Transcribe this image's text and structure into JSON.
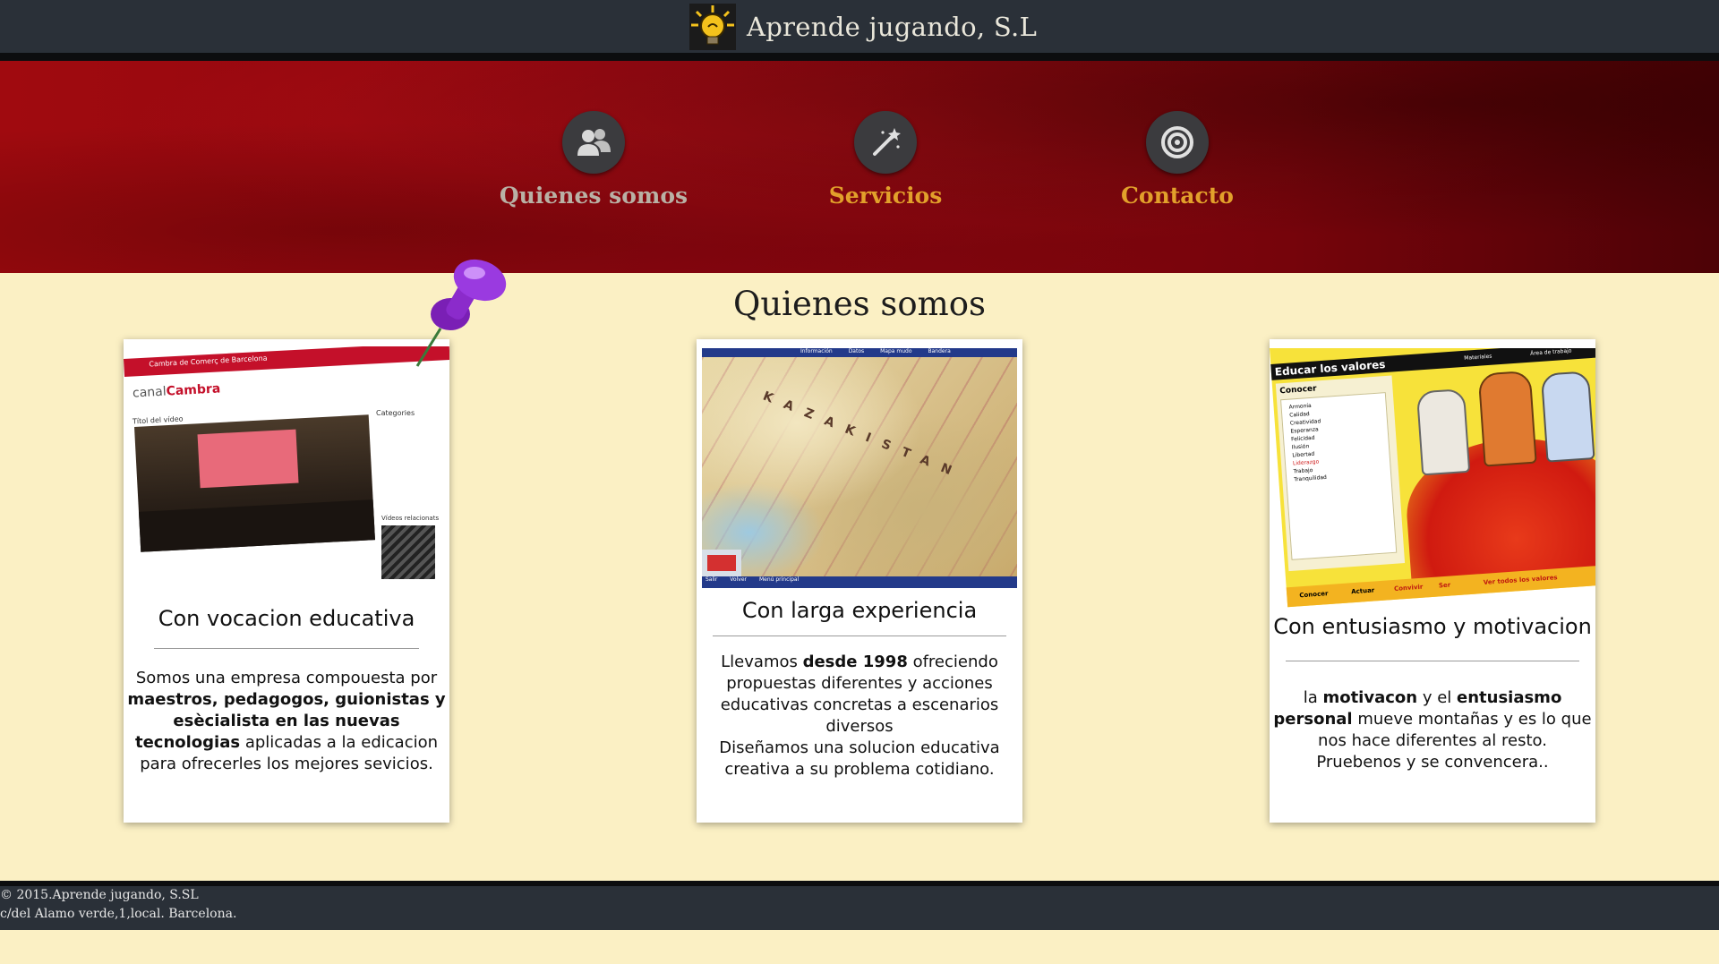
{
  "header": {
    "brand_name": "Aprende jugando, S.L"
  },
  "nav": {
    "items": [
      {
        "label": "Quienes somos",
        "icon": "users-icon",
        "color": "#b9b1a5"
      },
      {
        "label": "Servicios",
        "icon": "magic-wand-icon",
        "color": "#e2a02b"
      },
      {
        "label": "Contacto",
        "icon": "target-icon",
        "color": "#e2a02b"
      }
    ]
  },
  "main": {
    "section_title": "Quienes somos",
    "cards": [
      {
        "title": "Con vocacion educativa",
        "body": [
          {
            "text": "Somos una empresa compouesta por ",
            "bold": false
          },
          {
            "text": "maestros, pedagogos, guionistas y esècialista en las nuevas tecnologias",
            "bold": true
          },
          {
            "text": " aplicadas a la edicacion para ofrecerles los mejores sevicios.",
            "bold": false
          }
        ],
        "image": {
          "header_text": "Cambra de Comerç de Barcelona",
          "logo_text_a": "canal",
          "logo_text_b": "Cambra",
          "video_title": "Títol del vídeo",
          "side_heading": "Categories",
          "side_heading_2": "Vídeos relacionats"
        }
      },
      {
        "title": "Con larga experiencia",
        "body": [
          {
            "text": "Llevamos ",
            "bold": false
          },
          {
            "text": "desde 1998",
            "bold": true
          },
          {
            "text": " ofreciendo propuestas diferentes y acciones educativas concretas a escenarios diversos",
            "bold": false
          },
          {
            "text": "\n",
            "bold": false
          },
          {
            "text": "Diseñamos una solucion educativa creativa a su problema cotidiano.",
            "bold": false
          }
        ],
        "image": {
          "menu": [
            "Información",
            "Datos",
            "Mapa mudo",
            "Bandera"
          ],
          "map_label": "KAZAKISTAN",
          "bottom_menu": [
            "Salir",
            "Volver",
            "Menú principal"
          ]
        }
      },
      {
        "title": "Con entusiasmo y motivacion",
        "body": [
          {
            "text": "la ",
            "bold": false
          },
          {
            "text": "motivacon",
            "bold": true
          },
          {
            "text": " y el ",
            "bold": false
          },
          {
            "text": "entusiasmo personal",
            "bold": true
          },
          {
            "text": " mueve montañas y es lo que nos hace diferentes al resto.",
            "bold": false
          },
          {
            "text": "\n",
            "bold": false
          },
          {
            "text": "Pruebenos y se convencera..",
            "bold": false
          }
        ],
        "image": {
          "header_text": "Educar los valores",
          "top_links": [
            "Materiales",
            "Área de trabajo"
          ],
          "list_heading": "Conocer",
          "list_items": [
            "Armonía",
            "Calidad",
            "Creatividad",
            "Esperanza",
            "Felicidad",
            "Ilusión",
            "Libertad",
            "Liderazgo",
            "Trabajo",
            "Tranquilidad"
          ],
          "bottom_tabs": [
            "Conocer",
            "Actuar",
            "Convivir",
            "Ser",
            "Ver todos los valores"
          ]
        }
      }
    ]
  },
  "footer": {
    "line1": "© 2015.Aprende jugando, S.SL",
    "line2": "c/del Alamo verde,1,local. Barcelona."
  },
  "colors": {
    "background": "#fbf0c4",
    "topbar": "#2a3038",
    "accent": "#e2a02b",
    "hero_red": "#8e0610"
  }
}
